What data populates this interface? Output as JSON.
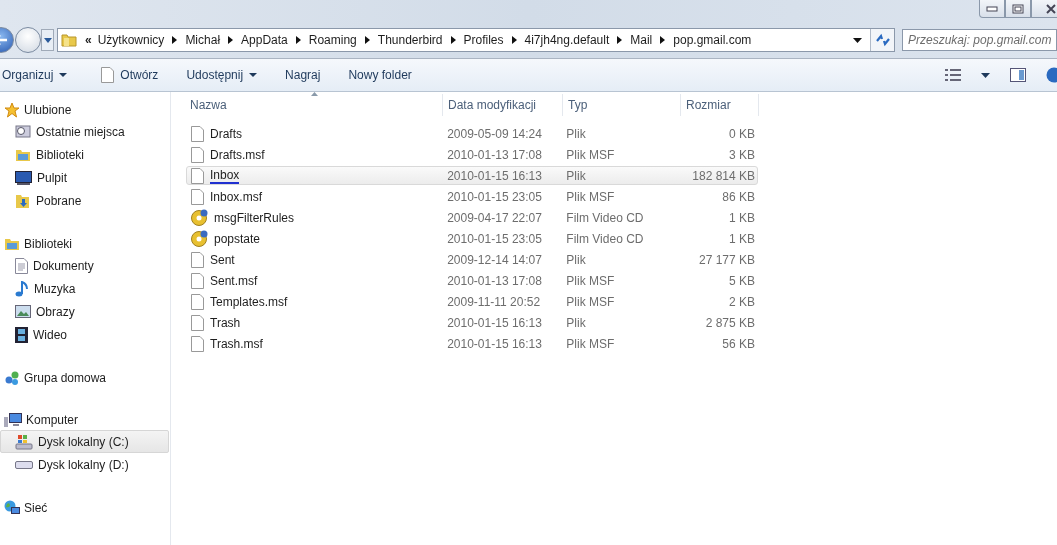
{
  "address": {
    "back_chevron": "«",
    "crumbs": [
      "Użytkownicy",
      "Michał",
      "AppData",
      "Roaming",
      "Thunderbird",
      "Profiles",
      "4i7jh4ng.default",
      "Mail",
      "pop.gmail.com"
    ]
  },
  "search": {
    "placeholder": "Przeszukaj: pop.gmail.com"
  },
  "toolbar": [
    {
      "label": "Organizuj",
      "dropdown": true,
      "icon": false
    },
    {
      "label": "Otwórz",
      "dropdown": false,
      "icon": true
    },
    {
      "label": "Udostępnij",
      "dropdown": true,
      "icon": false
    },
    {
      "label": "Nagraj",
      "dropdown": false,
      "icon": false
    },
    {
      "label": "Nowy folder",
      "dropdown": false,
      "icon": false
    }
  ],
  "sidebar": [
    {
      "label": "Ulubione",
      "children": [
        {
          "label": "Ostatnie miejsca",
          "selected": false
        },
        {
          "label": "Biblioteki",
          "selected": false
        },
        {
          "label": "Pulpit",
          "selected": false
        },
        {
          "label": "Pobrane",
          "selected": false
        }
      ]
    },
    {
      "label": "Biblioteki",
      "children": [
        {
          "label": "Dokumenty",
          "selected": false
        },
        {
          "label": "Muzyka",
          "selected": false
        },
        {
          "label": "Obrazy",
          "selected": false
        },
        {
          "label": "Wideo",
          "selected": false
        }
      ]
    },
    {
      "label": "Grupa domowa"
    },
    {
      "label": "Komputer",
      "children": [
        {
          "label": "Dysk lokalny (C:)",
          "selected": true
        },
        {
          "label": "Dysk lokalny (D:)",
          "selected": false
        }
      ]
    },
    {
      "label": "Sieć"
    }
  ],
  "table": {
    "columns": [
      "Nazwa",
      "Data modyfikacji",
      "Typ",
      "Rozmiar"
    ],
    "rows": [
      {
        "kind": "file",
        "name": "Drafts",
        "date": "2009-05-09 14:24",
        "type": "Plik",
        "size": "0 KB",
        "selected": false
      },
      {
        "kind": "file",
        "name": "Drafts.msf",
        "date": "2010-01-13 17:08",
        "type": "Plik MSF",
        "size": "3 KB",
        "selected": false
      },
      {
        "kind": "file",
        "name": "Inbox",
        "date": "2010-01-15 16:13",
        "type": "Plik",
        "size": "182 814 KB",
        "selected": true
      },
      {
        "kind": "file",
        "name": "Inbox.msf",
        "date": "2010-01-15 23:05",
        "type": "Plik MSF",
        "size": "86 KB",
        "selected": false
      },
      {
        "kind": "disc",
        "name": "msgFilterRules",
        "date": "2009-04-17 22:07",
        "type": "Film Video CD",
        "size": "1 KB",
        "selected": false
      },
      {
        "kind": "disc",
        "name": "popstate",
        "date": "2010-01-15 23:05",
        "type": "Film Video CD",
        "size": "1 KB",
        "selected": false
      },
      {
        "kind": "file",
        "name": "Sent",
        "date": "2009-12-14 14:07",
        "type": "Plik",
        "size": "27 177 KB",
        "selected": false
      },
      {
        "kind": "file",
        "name": "Sent.msf",
        "date": "2010-01-13 17:08",
        "type": "Plik MSF",
        "size": "5 KB",
        "selected": false
      },
      {
        "kind": "file",
        "name": "Templates.msf",
        "date": "2009-11-11 20:52",
        "type": "Plik MSF",
        "size": "2 KB",
        "selected": false
      },
      {
        "kind": "file",
        "name": "Trash",
        "date": "2010-01-15 16:13",
        "type": "Plik",
        "size": "2 875 KB",
        "selected": false
      },
      {
        "kind": "file",
        "name": "Trash.msf",
        "date": "2010-01-15 16:13",
        "type": "Plik MSF",
        "size": "56 KB",
        "selected": false
      }
    ]
  }
}
